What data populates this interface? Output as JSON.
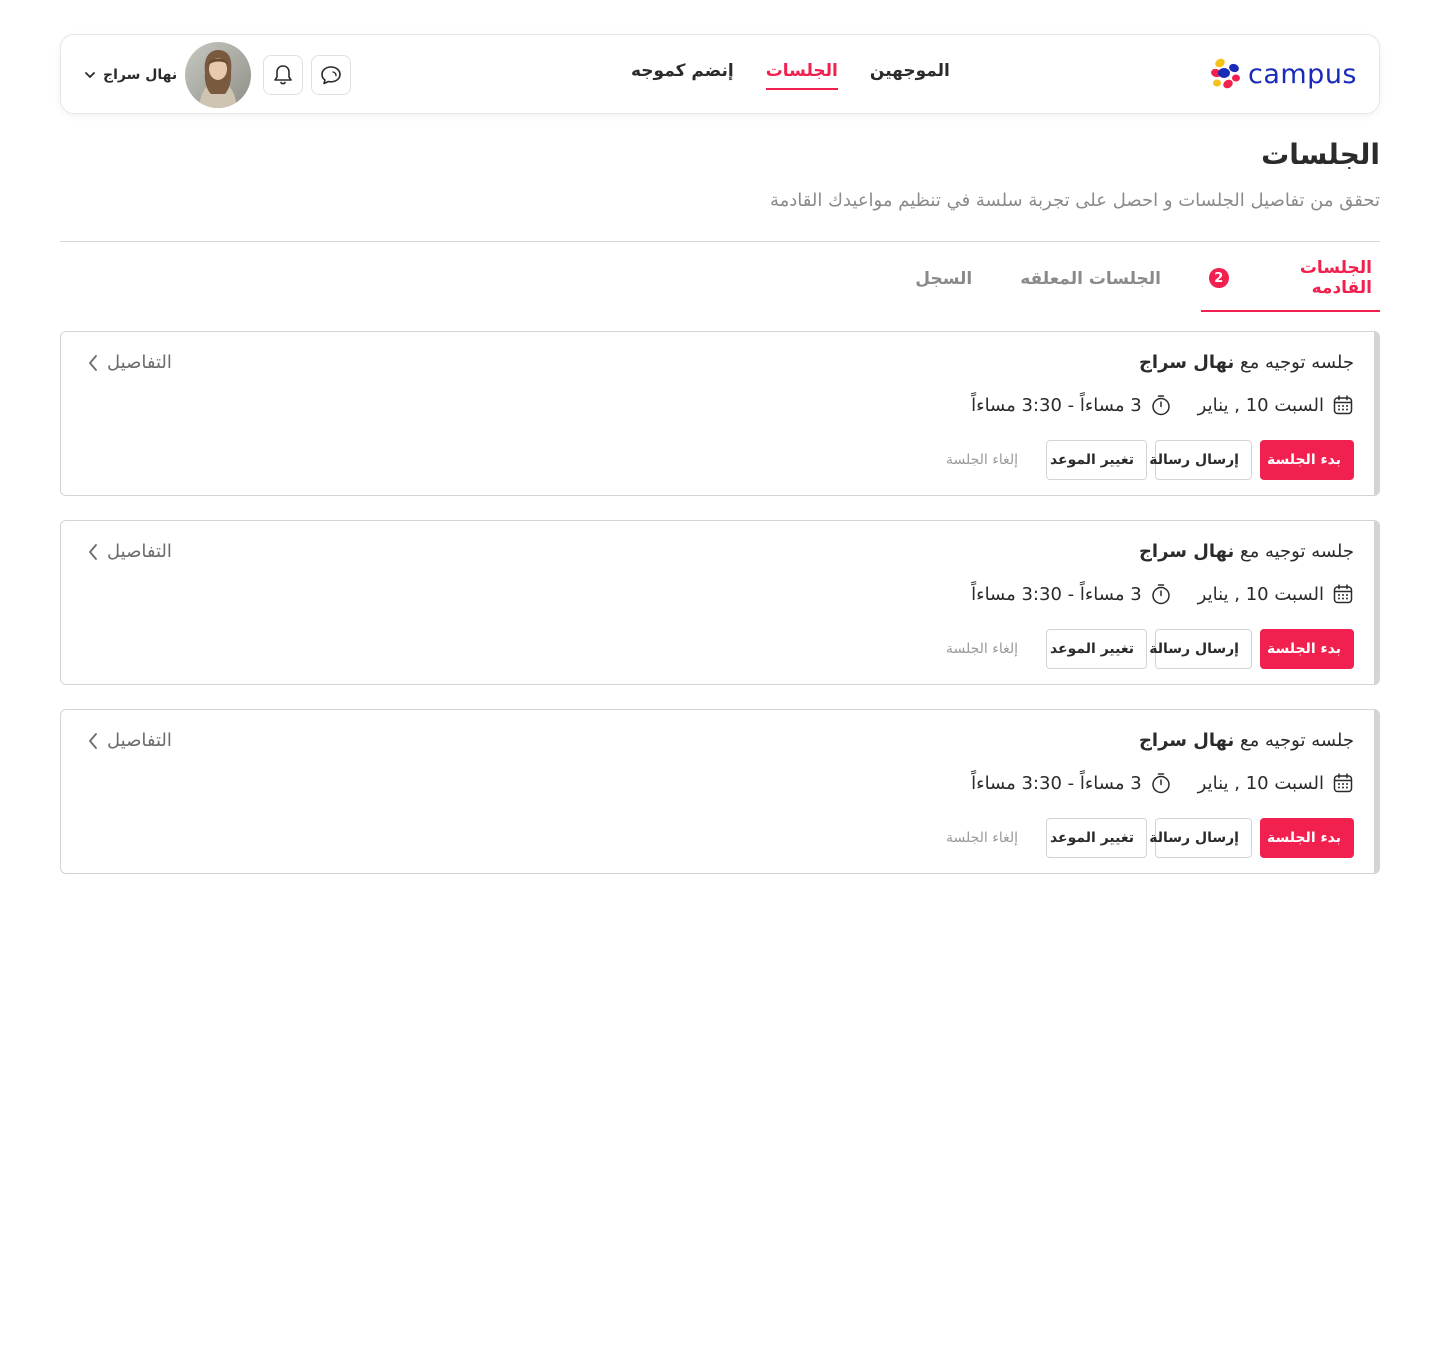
{
  "header": {
    "logo_text": "campus",
    "nav": [
      {
        "label": "الموجهين",
        "active": false
      },
      {
        "label": "الجلسات",
        "active": true
      },
      {
        "label": "إنضم كموجه",
        "active": false
      }
    ],
    "user_name": "نهال سراج",
    "icons": [
      "chat-icon",
      "bell-icon",
      "chevron-down-icon"
    ]
  },
  "page": {
    "title": "الجلسات",
    "subtitle": "تحقق من تفاصيل الجلسات و احصل على تجربة سلسة في تنظيم مواعيدك القادمة"
  },
  "tabs": [
    {
      "label": "الجلسات القادمه",
      "badge": "2",
      "active": true
    },
    {
      "label": "الجلسات المعلقه",
      "active": false
    },
    {
      "label": "السجل",
      "active": false
    }
  ],
  "sessions": [
    {
      "title_prefix": "جلسه توجيه مع",
      "mentor": "نهال سراج",
      "date": "السبت 10 , يناير",
      "time": "3 مساءاً - 3:30 مساءاً",
      "details_label": "التفاصيل",
      "start_label": "بدء الجلسة",
      "message_label": "إرسال رسالة",
      "reschedule_label": "تغيير الموعد",
      "cancel_label": "إلغاء الجلسة"
    },
    {
      "title_prefix": "جلسه توجيه مع",
      "mentor": "نهال سراج",
      "date": "السبت 10 , يناير",
      "time": "3 مساءاً - 3:30 مساءاً",
      "details_label": "التفاصيل",
      "start_label": "بدء الجلسة",
      "message_label": "إرسال رسالة",
      "reschedule_label": "تغيير الموعد",
      "cancel_label": "إلغاء الجلسة"
    },
    {
      "title_prefix": "جلسه توجيه مع",
      "mentor": "نهال سراج",
      "date": "السبت 10 , يناير",
      "time": "3 مساءاً - 3:30 مساءاً",
      "details_label": "التفاصيل",
      "start_label": "بدء الجلسة",
      "message_label": "إرسال رسالة",
      "reschedule_label": "تغيير الموعد",
      "cancel_label": "إلغاء الجلسة"
    }
  ],
  "colors": {
    "accent": "#f2204e",
    "brand_text": "#1a2bb8",
    "muted_text": "#8a8a8a",
    "border": "#d4d4d4"
  }
}
